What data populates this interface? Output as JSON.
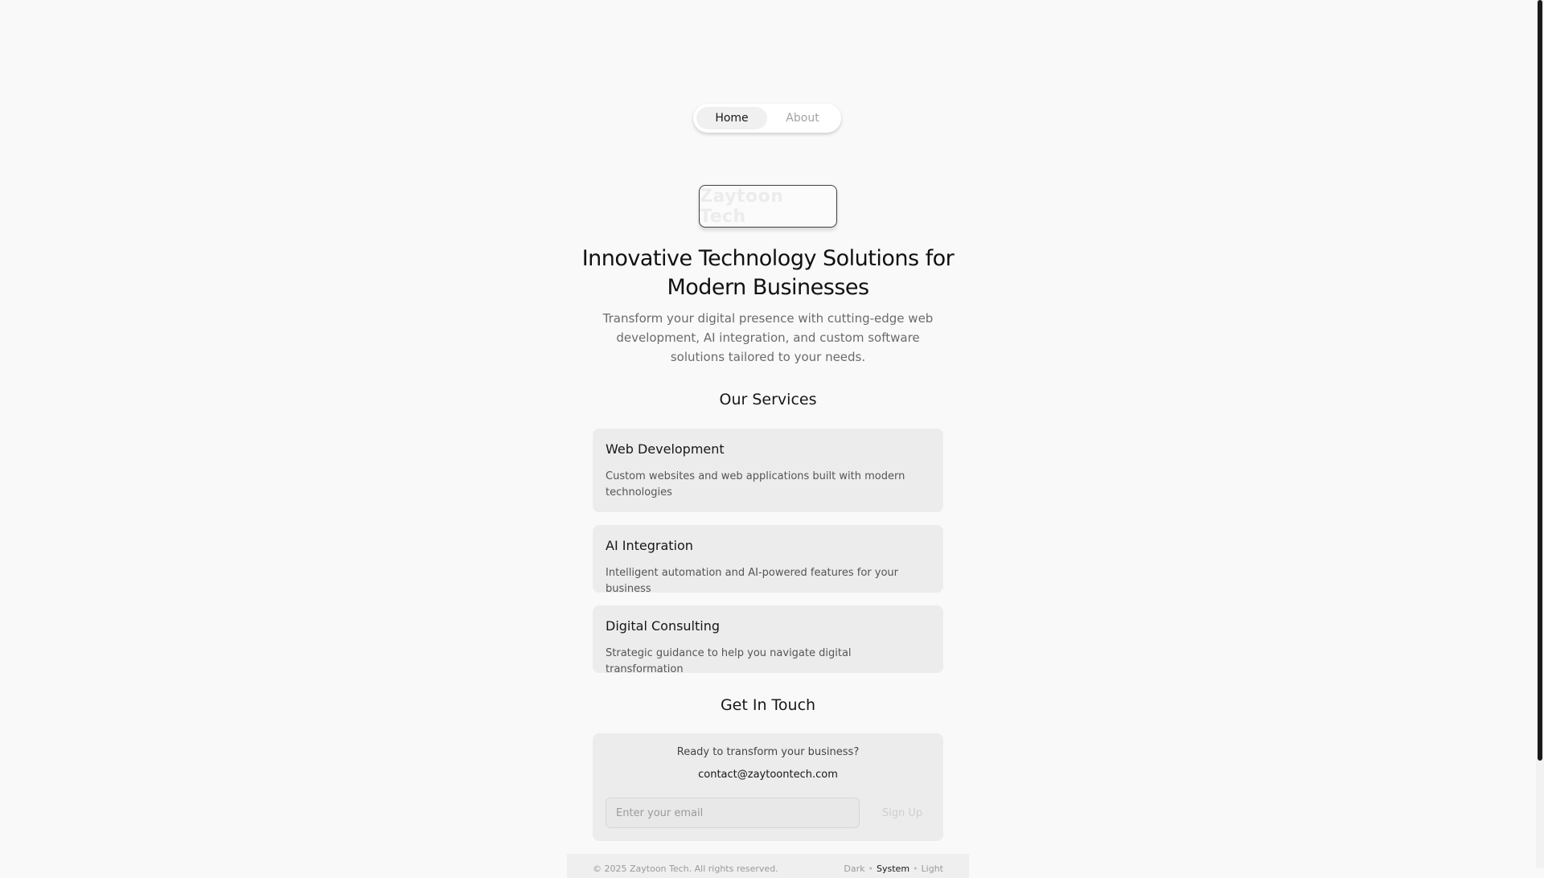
{
  "nav": {
    "items": [
      {
        "label": "Home",
        "active": true
      },
      {
        "label": "About",
        "active": false
      }
    ]
  },
  "logo": {
    "text": "Zaytoon Tech"
  },
  "hero": {
    "title": "Innovative Technology Solutions for Modern Businesses",
    "subtitle": "Transform your digital presence with cutting-edge web development, AI integration, and custom software solutions tailored to your needs."
  },
  "services": {
    "heading": "Our Services",
    "items": [
      {
        "title": "Web Development",
        "description": "Custom websites and web applications built with modern technologies"
      },
      {
        "title": "AI Integration",
        "description": "Intelligent automation and AI-powered features for your business"
      },
      {
        "title": "Digital Consulting",
        "description": "Strategic guidance to help you navigate digital transformation"
      }
    ]
  },
  "contact": {
    "heading": "Get In Touch",
    "question": "Ready to transform your business?",
    "email": "contact@zaytoontech.com",
    "input_placeholder": "Enter your email",
    "button_label": "Sign Up"
  },
  "footer": {
    "copyright": "© 2025 Zaytoon Tech. All rights reserved.",
    "theme_options": [
      "Dark",
      "System",
      "Light"
    ],
    "theme_active": "System"
  },
  "colors": {
    "background": "#f9f9f9",
    "card": "#ececec",
    "text": "#171717",
    "muted": "#6b6b6b"
  }
}
